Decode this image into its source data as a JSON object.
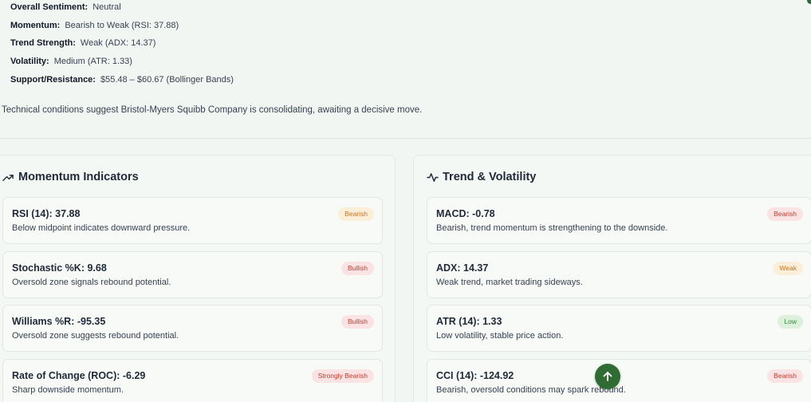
{
  "summary": {
    "rows": [
      {
        "key": "Overall Sentiment:",
        "value": "Neutral"
      },
      {
        "key": "Momentum:",
        "value": "Bearish to Weak (RSI: 37.88)"
      },
      {
        "key": "Trend Strength:",
        "value": "Weak (ADX: 14.37)"
      },
      {
        "key": "Volatility:",
        "value": "Medium (ATR: 1.33)"
      },
      {
        "key": "Support/Resistance:",
        "value": "$55.48 – $60.67 (Bollinger Bands)"
      }
    ],
    "note": "Technical conditions suggest Bristol-Myers Squibb Company is consolidating, awaiting a decisive move."
  },
  "momentum": {
    "title": "Momentum Indicators",
    "icon": "trending-up-icon",
    "cards": [
      {
        "title": "RSI (14): 37.88",
        "desc": "Below midpoint indicates downward pressure.",
        "badge": "Bearish",
        "tone": "orange"
      },
      {
        "title": "Stochastic %K: 9.68",
        "desc": "Oversold zone signals rebound potential.",
        "badge": "Bullish",
        "tone": "red"
      },
      {
        "title": "Williams %R: -95.35",
        "desc": "Oversold zone suggests rebound potential.",
        "badge": "Bullish",
        "tone": "red"
      },
      {
        "title": "Rate of Change (ROC): -6.29",
        "desc": "Sharp downside momentum.",
        "badge": "Strongly Bearish",
        "tone": "red"
      }
    ]
  },
  "trend": {
    "title": "Trend & Volatility",
    "icon": "activity-pulse-icon",
    "cards": [
      {
        "title": "MACD: -0.78",
        "desc": "Bearish, trend momentum is strengthening to the downside.",
        "badge": "Bearish",
        "tone": "red"
      },
      {
        "title": "ADX: 14.37",
        "desc": "Weak trend, market trading sideways.",
        "badge": "Weak",
        "tone": "orange"
      },
      {
        "title": "ATR (14): 1.33",
        "desc": "Low volatility, stable price action.",
        "badge": "Low",
        "tone": "green"
      },
      {
        "title": "CCI (14): -124.92",
        "desc": "Bearish, oversold conditions may spark rebound.",
        "badge": "Bearish",
        "tone": "red"
      }
    ]
  },
  "scroll_top": {
    "icon": "arrow-up-icon"
  },
  "colors": {
    "accent": "#2f6b32",
    "bearish": "#c0392b",
    "weak": "#c8731a",
    "low": "#2e8b3a"
  }
}
